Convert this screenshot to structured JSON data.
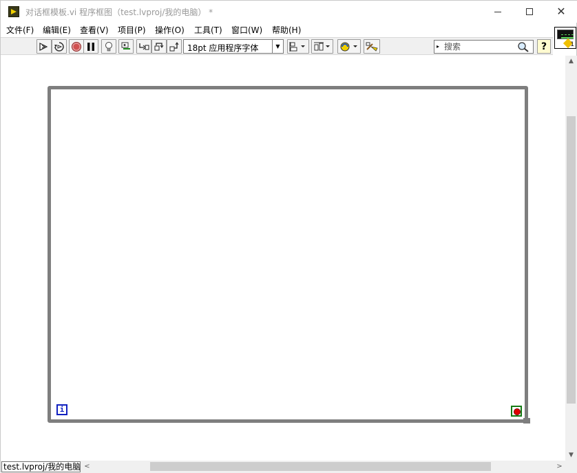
{
  "window": {
    "title": "对话框模板.vi 程序框图（test.lvproj/我的电脑） *"
  },
  "menu": {
    "items": [
      "文件(F)",
      "编辑(E)",
      "查看(V)",
      "项目(P)",
      "操作(O)",
      "工具(T)",
      "窗口(W)",
      "帮助(H)"
    ]
  },
  "toolbar": {
    "font_label": "18pt 应用程序字体",
    "search_placeholder": "搜索",
    "help_label": "?"
  },
  "vi_icon": {
    "number": "1"
  },
  "diagram": {
    "iteration_label": "i"
  },
  "status": {
    "context": "test.lvproj/我的电脑"
  },
  "colors": {
    "loop_border": "#7e7e7e",
    "iteration_terminal": "#1020c0",
    "stop_terminal_border": "#137a13",
    "stop_terminal_fill": "#e00000"
  }
}
